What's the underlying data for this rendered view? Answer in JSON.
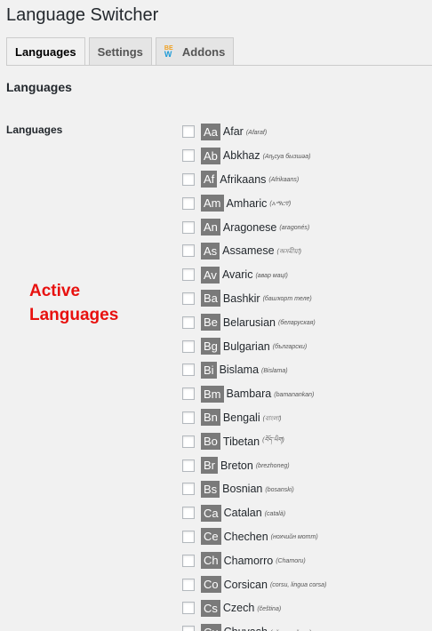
{
  "page": {
    "title": "Language Switcher"
  },
  "tabs": [
    {
      "label": "Languages"
    },
    {
      "label": "Settings"
    },
    {
      "label": "Addons",
      "icon_text_top": "BE",
      "icon_text_bottom": "W"
    }
  ],
  "section": {
    "heading": "Languages",
    "field_label": "Languages"
  },
  "annotation": {
    "line1": "Active",
    "line2": "Languages",
    "color": "#e8110f"
  },
  "colors": {
    "badge": "#7a7a7a",
    "background": "#f1f1f1"
  },
  "languages": [
    {
      "code": "Aa",
      "name": "Afar",
      "native": "(Afaraf)"
    },
    {
      "code": "Ab",
      "name": "Abkhaz",
      "native": "(Аҧсуа бызшәа)"
    },
    {
      "code": "Af",
      "name": "Afrikaans",
      "native": "(Afrikaans)"
    },
    {
      "code": "Am",
      "name": "Amharic",
      "native": "(አማርኛ)"
    },
    {
      "code": "An",
      "name": "Aragonese",
      "native": "(aragonés)"
    },
    {
      "code": "As",
      "name": "Assamese",
      "native": "(অসমীয়া)"
    },
    {
      "code": "Av",
      "name": "Avaric",
      "native": "(авар мацӀ)"
    },
    {
      "code": "Ba",
      "name": "Bashkir",
      "native": "(башҡорт теле)"
    },
    {
      "code": "Be",
      "name": "Belarusian",
      "native": "(беларуская)"
    },
    {
      "code": "Bg",
      "name": "Bulgarian",
      "native": "(български)"
    },
    {
      "code": "Bi",
      "name": "Bislama",
      "native": "(Bislama)"
    },
    {
      "code": "Bm",
      "name": "Bambara",
      "native": "(bamanankan)"
    },
    {
      "code": "Bn",
      "name": "Bengali",
      "native": "(বাংলা)"
    },
    {
      "code": "Bo",
      "name": "Tibetan",
      "native": "(བོད་ཡིག)"
    },
    {
      "code": "Br",
      "name": "Breton",
      "native": "(brezhoneg)"
    },
    {
      "code": "Bs",
      "name": "Bosnian",
      "native": "(bosanski)"
    },
    {
      "code": "Ca",
      "name": "Catalan",
      "native": "(català)"
    },
    {
      "code": "Ce",
      "name": "Chechen",
      "native": "(нохчийн мотт)"
    },
    {
      "code": "Ch",
      "name": "Chamorro",
      "native": "(Chamoru)"
    },
    {
      "code": "Co",
      "name": "Corsican",
      "native": "(corsu, lingua corsa)"
    },
    {
      "code": "Cs",
      "name": "Czech",
      "native": "(čeština)"
    },
    {
      "code": "Cu",
      "name": "Chuvash",
      "native": "(чӑваш чӗлхи)"
    }
  ]
}
